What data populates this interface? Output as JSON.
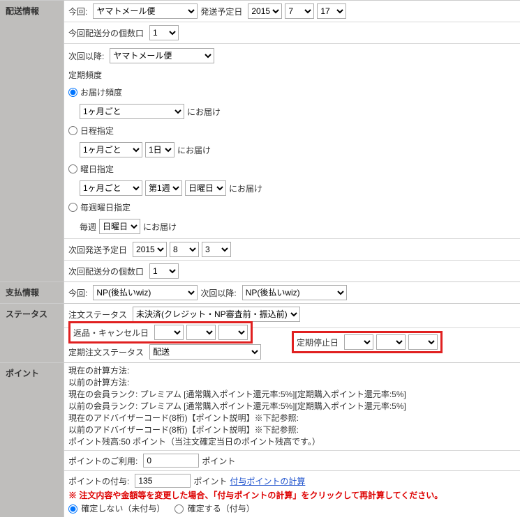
{
  "shipping": {
    "title": "配送情報",
    "this_time": "今回:",
    "method": "ヤマトメール便",
    "ship_date_label": "発送予定日",
    "ship_year": "2015",
    "ship_month": "7",
    "ship_day": "17",
    "boxes_label": "今回配送分の個数口",
    "boxes": "1",
    "next_label": "次回以降:",
    "next_method": "ヤマトメール便",
    "recur_label": "定期頻度",
    "r1": "お届け頻度",
    "r1_sel": "1ヶ月ごと",
    "r1_suffix": "にお届け",
    "r2": "日程指定",
    "r2_sel1": "1ヶ月ごと",
    "r2_sel2": "1日",
    "r2_suffix": "にお届け",
    "r3": "曜日指定",
    "r3_sel1": "1ヶ月ごと",
    "r3_sel2": "第1週",
    "r3_sel3": "日曜日",
    "r3_suffix": "にお届け",
    "r4": "毎週曜日指定",
    "r4_label": "毎週",
    "r4_sel": "日曜日",
    "r4_suffix": "にお届け",
    "next_ship_label": "次回発送予定日",
    "next_year": "2015",
    "next_month": "8",
    "next_day": "3",
    "next_boxes_label": "次回配送分の個数口",
    "next_boxes": "1"
  },
  "payment": {
    "title": "支払情報",
    "this_time": "今回:",
    "method": "NP(後払いwiz)",
    "next_label": "次回以降:",
    "next_method": "NP(後払いwiz)"
  },
  "status": {
    "title": "ステータス",
    "order_status_label": "注文ステータス",
    "order_status": "未決済(クレジット・NP審査前・振込前)",
    "cancel_label": "返品・キャンセル日",
    "cancel_y": "",
    "cancel_m": "",
    "cancel_d": "",
    "sub_status_label": "定期注文ステータス",
    "sub_status": "配送",
    "stop_label": "定期停止日",
    "stop_y": "",
    "stop_m": "",
    "stop_d": ""
  },
  "point": {
    "title": "ポイント",
    "calc_current": "現在の計算方法:",
    "calc_prev": "以前の計算方法:",
    "rank_current": "現在の会員ランク: プレミアム  [通常購入ポイント還元率:5%][定期購入ポイント還元率:5%]",
    "rank_prev": "以前の会員ランク: プレミアム  [通常購入ポイント還元率:5%][定期購入ポイント還元率:5%]",
    "adv_current": "現在のアドバイザーコード(8桁)【ポイント説明】※下記参照:",
    "adv_prev": "以前のアドバイザーコード(8桁)【ポイント説明】※下記参照:",
    "balance": "ポイント残高:50 ポイント（当注文確定当日のポイント残高です。）",
    "use_label": "ポイントのご利用:",
    "use_val": "0",
    "unit": "ポイント",
    "grant_label": "ポイントの付与:",
    "grant_val": "135",
    "grant_link": "付与ポイントの計算",
    "note": "※ 注文内容や金額等を変更した場合、「付与ポイントの計算」をクリックして再計算してください。",
    "fix_no": "確定しない（未付与）",
    "fix_yes": "確定する（付与）"
  }
}
